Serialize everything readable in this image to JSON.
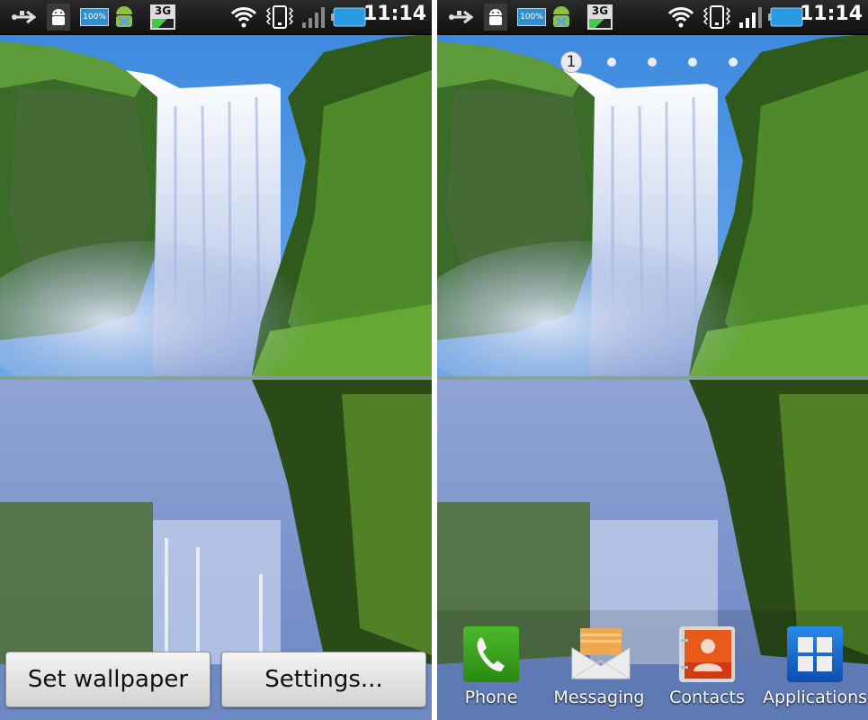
{
  "status_bar": {
    "icons": [
      "usb-icon",
      "android-debug-icon",
      "battery-100-badge-icon",
      "android-download-icon",
      "3g-icon",
      "wifi-icon",
      "vibrate-icon",
      "signal-icon",
      "battery-icon"
    ],
    "battery_badge_text": "100%",
    "network_text": "3G",
    "time": "11:14"
  },
  "left_panel": {
    "description": "Live wallpaper preview - waterfall",
    "buttons": {
      "set_wallpaper": "Set wallpaper",
      "settings": "Settings..."
    }
  },
  "right_panel": {
    "description": "Home screen with waterfall live wallpaper",
    "page_indicator": {
      "current_page": "1",
      "total_pages": 5
    },
    "dock": [
      {
        "label": "Phone",
        "icon": "phone-icon",
        "color": "#3a9a1e"
      },
      {
        "label": "Messaging",
        "icon": "envelope-icon",
        "color": "#f0a850"
      },
      {
        "label": "Contacts",
        "icon": "contacts-icon",
        "color": "#e0501a"
      },
      {
        "label": "Applications",
        "icon": "app-grid-icon",
        "color": "#1a66c8"
      }
    ]
  }
}
